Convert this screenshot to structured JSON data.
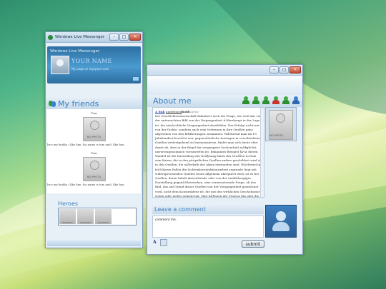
{
  "messenger": {
    "window_title": "Windows Live Messenger",
    "header_title": "Windows Live Messenger",
    "your_name": "YOUR NAME",
    "my_page": "My page on myspace.com",
    "friends_title": "My friends",
    "friends": [
      {
        "name": "Tom",
        "photo_label": "NO PHOTO",
        "description": "he's my buddy. i like him. his name is tom and i like him"
      },
      {
        "name": "Tom",
        "photo_label": "NO PHOTO",
        "description": "he's my buddy. i like him. his name is tom and i like him"
      }
    ],
    "heroes_title": "Heroes",
    "heroes": [
      "NO PHOTO",
      "NO PHOTO",
      "NO PHOTO"
    ]
  },
  "profile": {
    "about_title": "About me",
    "link_text": "A link",
    "underline_text": "underlined",
    "bold_text": "bold",
    "italic_text": "Kursiv",
    "about_body": "Die Geschichtswissenschaft diskutiert noch die Frage, wie weit das von der untersuchten Bild von der Vergangenheit Ã¼berhaupt in der Lage ist, die tatsÃ¤chliche Vergangenheit abzubilden. Das Erfolgt nicht nur von der Dichte, sondern auch vom Vertrauen in ihre Quellen ganz abgesehen von den ErklÃ¤rungen zusammen. WÃ¤hrend man im 19. Jahrhundert bereÃ¼t war, gegensÃ¤tzliche Aussagen in verschiedenen Quellen weitestgehend zu harmonisieren, findet man sich heute eher damit ab, dass in der Regel der vergangene Sachverhalt mÃ¶glichst unvoreingenommen vorzuwerfen ist. Bekanntes Beispiel fÃ¼r diesen Wandel ist die Darstellung der KrÃ¶nung Karls des GroÃŸen in Rom zum Kaiser, die in den pÃ¤pstlichen Quellen anders geschildert wird als in den Quellen, die aÃŸerhalb der Alpen entstanden sind. WÃ¤hrend in frÃ¼heren Fallen die Sichtenkonstruktionsarbeit zugrunde liegt mit widersprechenden Quellen heute allgemein akzeptiert wird, ist es bei Quellen, deren Inhalt abweichende oder von der unabhÃ¤ngiger Darstellung gegenÃ¼berstehen, eine voraussetzende Frage, ob das Bild, das auf Grund dieser Quellen von der Vergangenheit gezeichnet wird, nicht dem Konstrukteur ist, die mit den wirklichen Geschehnissen wenig oder nichts gemein hat. Hier kÃ¶nnen der Prozess hin oder die HintergrÃ¼nde der Konstruktion des Bildes zu erforschen. Dabei wird nun einen die Relevanz der Historiographie.",
    "photo_label": "NO PHOTO",
    "leave_comment_title": "Leave a comment",
    "comment_value": "comment me.",
    "submit_label": "submit",
    "format_a": "A"
  }
}
